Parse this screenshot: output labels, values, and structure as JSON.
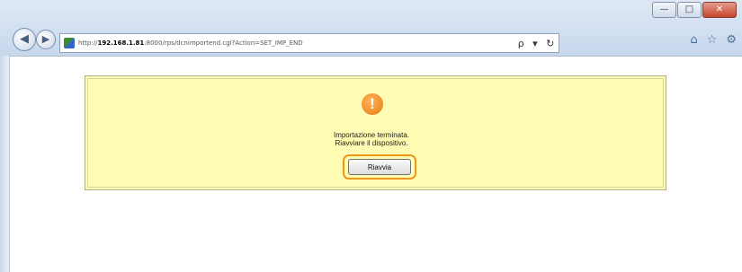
{
  "window": {
    "minimize_label": "—",
    "maximize_label": "□",
    "close_label": "✕"
  },
  "nav": {
    "back_icon": "◀",
    "forward_icon": "▶"
  },
  "address": {
    "scheme": "http://",
    "host": "192.168.1.81",
    "path": ":8000/rps/dcnimportend.cgi?Action=SET_IMP_END",
    "search_icon": "ρ",
    "dropdown_icon": "▾",
    "refresh_icon": "↻"
  },
  "toolbar": {
    "home_icon": "⌂",
    "favorites_icon": "☆",
    "settings_icon": "⚙"
  },
  "dialog": {
    "icon": "!",
    "line1": "Importazione terminata.",
    "line2": "Riavviare il dispositivo.",
    "restart_label": "Riavvia",
    "accent": "#f0961c"
  }
}
